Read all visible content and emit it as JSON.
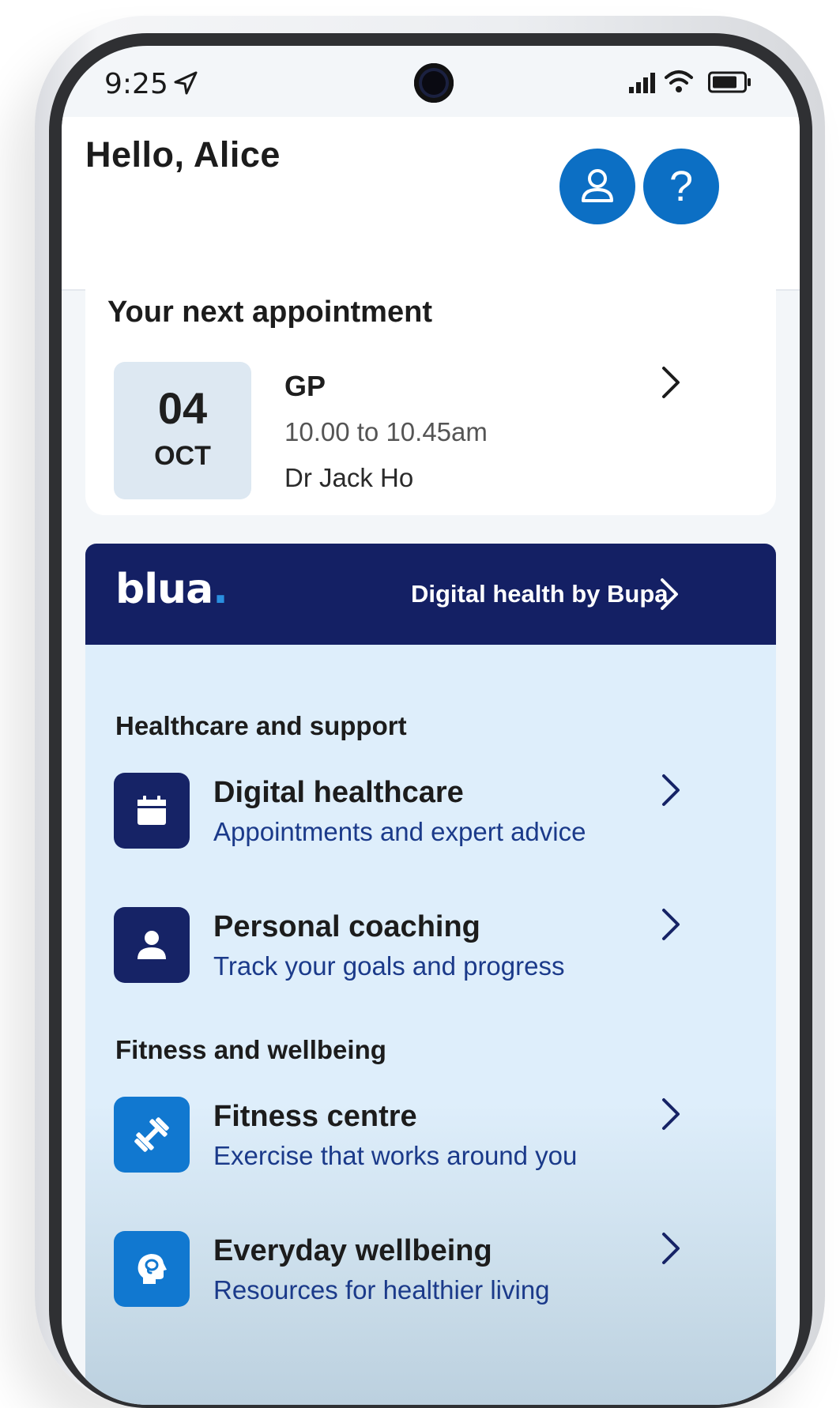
{
  "status_bar": {
    "time": "9:25"
  },
  "header": {
    "greeting": "Hello, Alice",
    "help_label": "?"
  },
  "appointment": {
    "title": "Your next appointment",
    "day": "04",
    "month": "OCT",
    "type": "GP",
    "time": "10.00 to 10.45am",
    "doctor": "Dr Jack Ho"
  },
  "blua": {
    "logo_text": "blua",
    "logo_dot": ".",
    "tagline": "Digital health by Bupa"
  },
  "sections": [
    {
      "heading": "Healthcare and support",
      "items": [
        {
          "title": "Digital healthcare",
          "subtitle": "Appointments and expert advice",
          "icon": "calendar-icon"
        },
        {
          "title": "Personal coaching",
          "subtitle": "Track your goals and progress",
          "icon": "person-icon"
        }
      ]
    },
    {
      "heading": "Fitness and wellbeing",
      "items": [
        {
          "title": "Fitness centre",
          "subtitle": "Exercise that works around you",
          "icon": "dumbbell-icon"
        },
        {
          "title": "Everyday wellbeing",
          "subtitle": "Resources for healthier living",
          "icon": "head-icon"
        }
      ]
    }
  ],
  "colors": {
    "primary_blue": "#0c6fc4",
    "navy": "#142064",
    "panel": "#deeefb"
  }
}
